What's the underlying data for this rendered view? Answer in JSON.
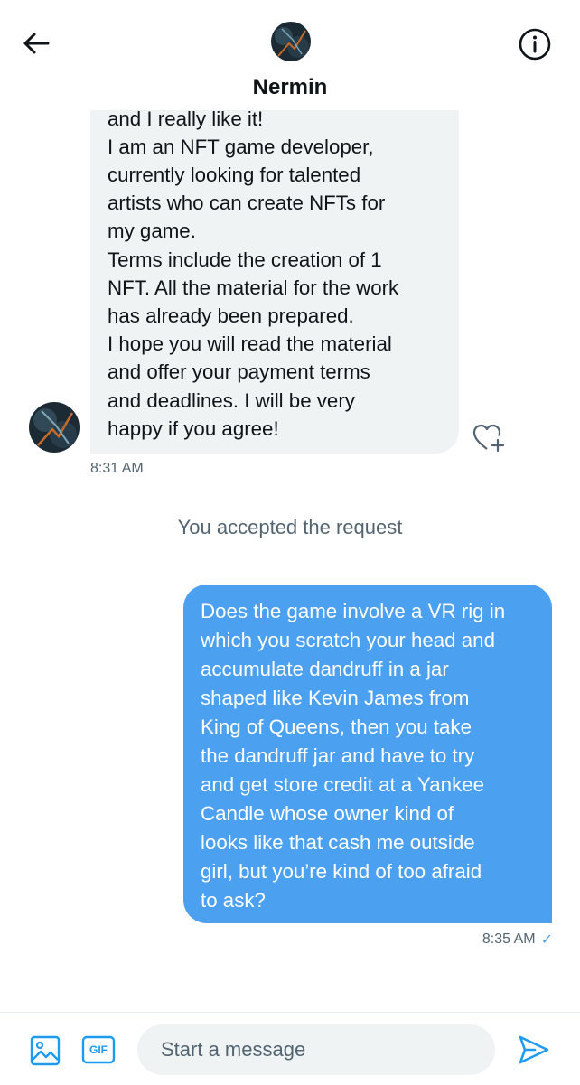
{
  "header": {
    "name": "Nermin",
    "back_icon": "back-arrow-icon",
    "info_icon": "info-icon"
  },
  "incoming_message": {
    "text": "and I really like it!\nI am an NFT game developer,\ncurrently looking for talented\nartists who can create NFTs for\nmy game.\nTerms include the creation of 1\nNFT. All the material for the work\nhas already been prepared.\nI hope you will read the material\nand offer your payment terms\nand deadlines. I will be very\nhappy if you agree!",
    "time": "8:31 AM"
  },
  "system_note": "You accepted the request",
  "outgoing_message": {
    "text": "Does the game involve a VR rig in\nwhich you scratch your head and\naccumulate dandruff in a jar\nshaped like Kevin James from\nKing of Queens, then you take\nthe dandruff jar and have to try\nand get store credit at a Yankee\nCandle whose owner kind of\nlooks like that cash me outside\ngirl, but you’re kind of too afraid\nto ask?",
    "time": "8:35 AM",
    "status_icon": "check-icon"
  },
  "composer": {
    "placeholder": "Start a message",
    "value": "",
    "gif_label": "GIF"
  },
  "colors": {
    "accent": "#1d9bf0",
    "outgoing_bubble": "#4ca0f0",
    "incoming_bubble": "#eff3f4",
    "secondary_text": "#536471"
  }
}
